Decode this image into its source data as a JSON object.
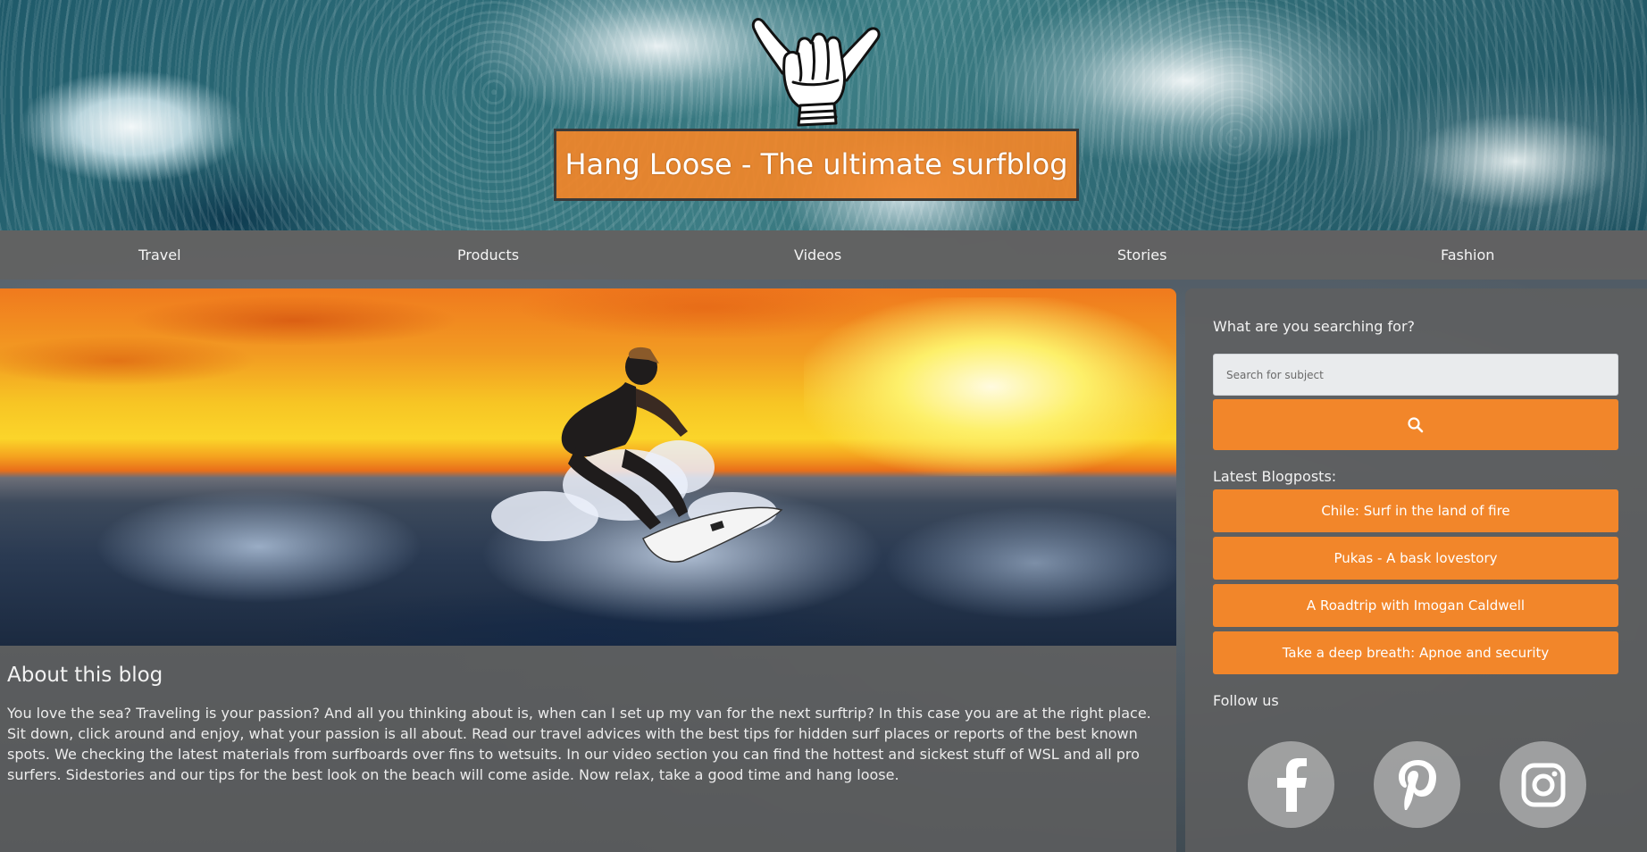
{
  "header": {
    "logo_icon": "shaka-hand-icon",
    "title": "Hang Loose - The ultimate surfblog"
  },
  "nav": {
    "items": [
      {
        "label": "Travel"
      },
      {
        "label": "Products"
      },
      {
        "label": "Videos"
      },
      {
        "label": "Stories"
      },
      {
        "label": "Fashion"
      }
    ]
  },
  "main": {
    "hero_image": "surfer-sunset-photo",
    "about_title": "About this blog",
    "about_text": "You love the sea? Traveling is your passion? And all you thinking about is, when can I set up my van for the next surftrip? In this case you are at the right place. Sit down, click around and enjoy, what your passion is all about. Read our travel advices with the best tips for hidden surf places or reports of the best known spots. We checking the latest materials from surfboards over fins to wetsuits. In our video section you can find the hottest and sickest stuff of WSL and all pro surfers. Sidestories and our tips for the best look on the beach will come aside. Now relax, take a good time and hang loose."
  },
  "sidebar": {
    "search_label": "What are you searching for?",
    "search_placeholder": "Search for subject",
    "search_icon": "search-icon",
    "latest_label": "Latest Blogposts:",
    "posts": [
      {
        "title": "Chile: Surf in the land of fire"
      },
      {
        "title": "Pukas - A bask lovestory"
      },
      {
        "title": "A Roadtrip with Imogan Caldwell"
      },
      {
        "title": "Take a deep breath: Apnoe and security"
      }
    ],
    "follow_label": "Follow us",
    "social": [
      {
        "icon": "facebook-icon"
      },
      {
        "icon": "pinterest-icon"
      },
      {
        "icon": "instagram-icon"
      }
    ]
  },
  "colors": {
    "accent": "#f2862a",
    "panel": "#5f5f5f",
    "nav": "#626262"
  }
}
